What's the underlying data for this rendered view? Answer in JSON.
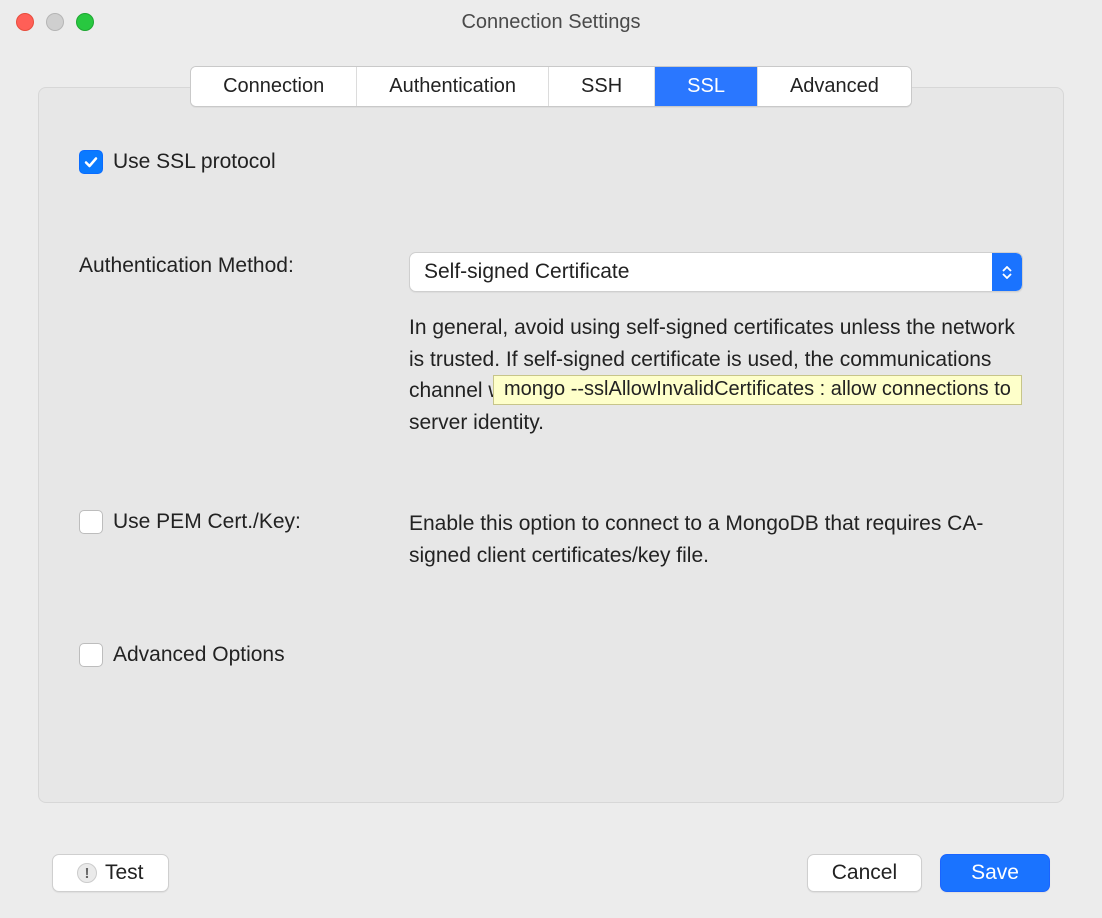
{
  "window": {
    "title": "Connection Settings"
  },
  "tabs": {
    "connection": "Connection",
    "authentication": "Authentication",
    "ssh": "SSH",
    "ssl": "SSL",
    "advanced": "Advanced",
    "active": "ssl"
  },
  "ssl": {
    "use_ssl": {
      "label": "Use SSL protocol",
      "checked": true
    },
    "auth_method": {
      "label": "Authentication Method:",
      "value": "Self-signed Certificate",
      "description": "In general, avoid using self-signed certificates unless the network is trusted. If self-signed certificate is used, the communications channel will be encrypted however there will be no validation of server identity."
    },
    "use_pem": {
      "label": "Use PEM Cert./Key:",
      "checked": false,
      "description": "Enable this option to connect to a MongoDB that requires CA-signed client certificates/key file."
    },
    "advanced_options": {
      "label": "Advanced Options",
      "checked": false
    }
  },
  "tooltip": {
    "text": "mongo --sslAllowInvalidCertificates : allow connections to"
  },
  "buttons": {
    "test": "Test",
    "cancel": "Cancel",
    "save": "Save"
  }
}
